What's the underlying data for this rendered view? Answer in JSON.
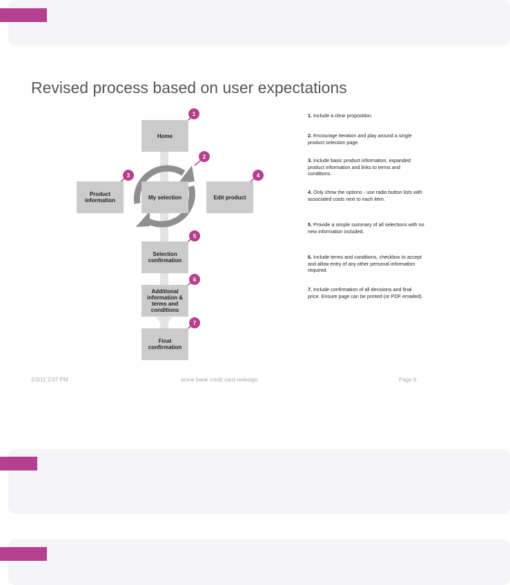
{
  "colors": {
    "accent": "#b5408f",
    "box": "#cbcbcb",
    "track": "#e4e4e4",
    "arrows": "#8f8f8f",
    "panel": "#f5f5f7"
  },
  "slide": {
    "title": "Revised process based on user expectations",
    "boxes": {
      "home": "Home",
      "my_selection": "My selection",
      "product_information": "Product information",
      "edit_product": "Edit product",
      "selection_confirmation": "Selection confirmation",
      "additional_information": "Additional information & terms and conditions",
      "final_confirmation": "Final confirmation"
    },
    "markers": [
      "1",
      "2",
      "3",
      "4",
      "5",
      "6",
      "7"
    ],
    "steps": [
      {
        "num": "1.",
        "text": "Include a clear proposition."
      },
      {
        "num": "2.",
        "text": "Encourage iteration and play around a single product selection page."
      },
      {
        "num": "3.",
        "text": "Include basic product information, expanded product information and links to terms and conditions."
      },
      {
        "num": "4.",
        "text": "Only show the options - use radio button lists with associated costs next to each item."
      },
      {
        "num": "5.",
        "text": "Provide a simple summary of all selections with no new information included."
      },
      {
        "num": "6.",
        "text": "Include terms and conditions, checkbox to accept and allow entry of any other personal information required."
      },
      {
        "num": "7.",
        "text": "Include confirmation of all decisions and final price. Ensure page can be printed (or PDF emailed)."
      }
    ],
    "footer": {
      "date": "2/3/11 2:07 PM",
      "project": "acme bank credit card redesign",
      "page": "Page 6"
    }
  }
}
